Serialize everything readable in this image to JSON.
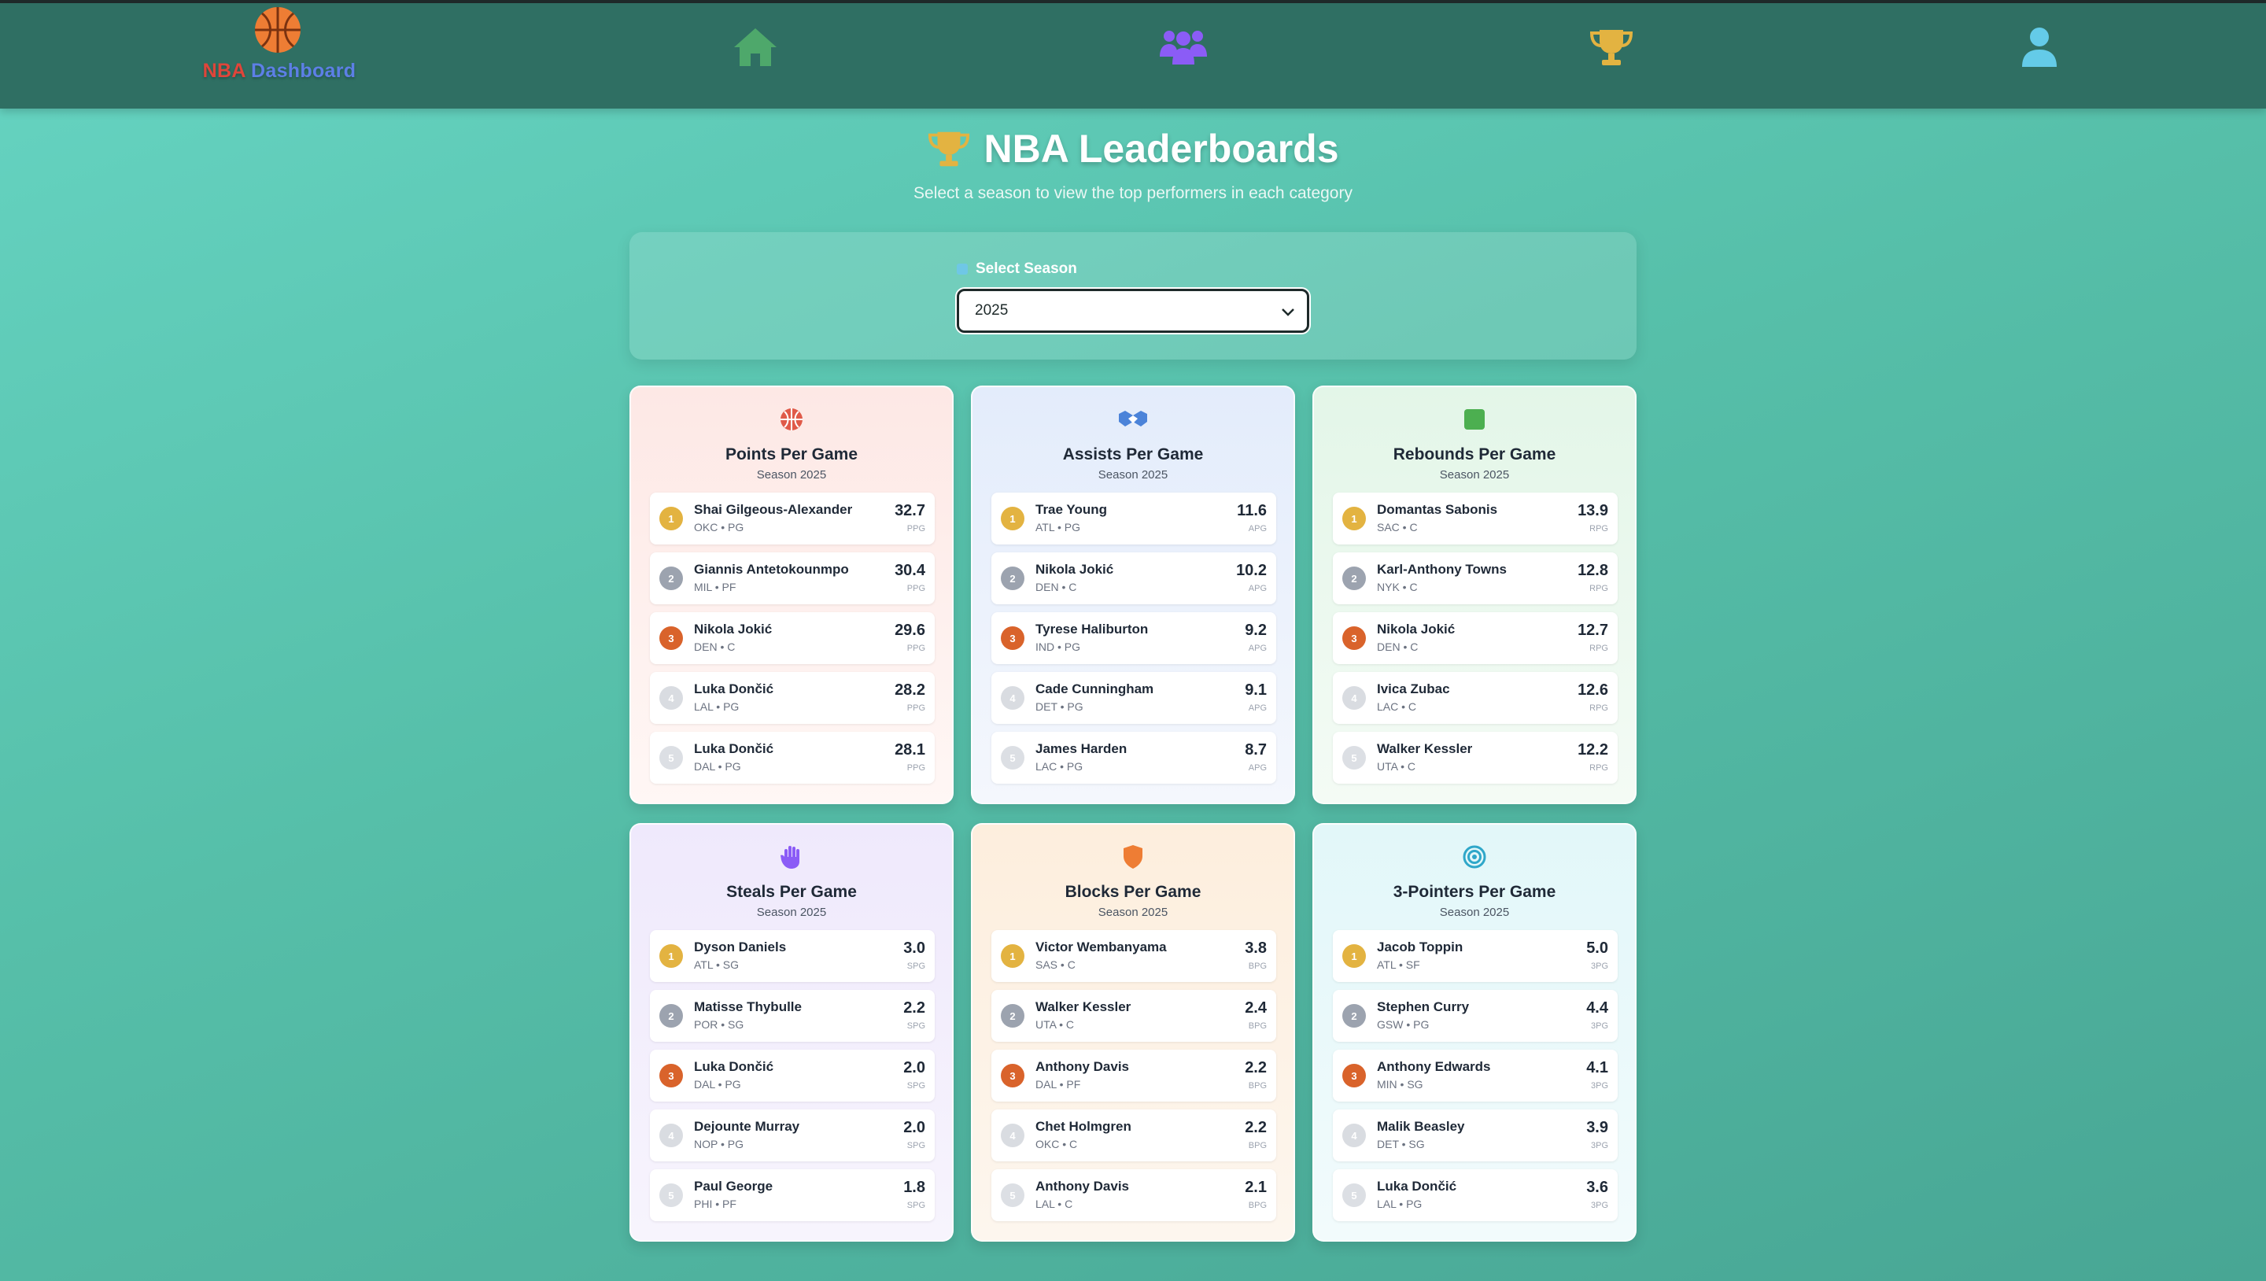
{
  "brand": {
    "nba": "NBA",
    "dashboard": "Dashboard"
  },
  "nav": {
    "icons": [
      "home-icon",
      "teams-icon",
      "trophy-icon",
      "user-icon"
    ],
    "colors": {
      "home": "#4ea86b",
      "teams": "#8b5cf6",
      "trophy": "#e3b341",
      "user": "#64cbe8"
    }
  },
  "header": {
    "title": "NBA Leaderboards",
    "subtitle": "Select a season to view the top performers in each category"
  },
  "season": {
    "label": "Select Season",
    "value": "2025"
  },
  "cards": [
    {
      "title": "Points Per Game",
      "season": "Season 2025",
      "icon": "basketball-icon",
      "players": [
        {
          "rank": "1",
          "name": "Shai Gilgeous-Alexander",
          "meta": "OKC • PG",
          "value": "32.7",
          "unit": "PPG"
        },
        {
          "rank": "2",
          "name": "Giannis Antetokounmpo",
          "meta": "MIL • PF",
          "value": "30.4",
          "unit": "PPG"
        },
        {
          "rank": "3",
          "name": "Nikola Jokić",
          "meta": "DEN • C",
          "value": "29.6",
          "unit": "PPG"
        },
        {
          "rank": "4",
          "name": "Luka Dončić",
          "meta": "LAL • PG",
          "value": "28.2",
          "unit": "PPG"
        },
        {
          "rank": "5",
          "name": "Luka Dončić",
          "meta": "DAL • PG",
          "value": "28.1",
          "unit": "PPG"
        }
      ]
    },
    {
      "title": "Assists Per Game",
      "season": "Season 2025",
      "icon": "handshake-icon",
      "players": [
        {
          "rank": "1",
          "name": "Trae Young",
          "meta": "ATL • PG",
          "value": "11.6",
          "unit": "APG"
        },
        {
          "rank": "2",
          "name": "Nikola Jokić",
          "meta": "DEN • C",
          "value": "10.2",
          "unit": "APG"
        },
        {
          "rank": "3",
          "name": "Tyrese Haliburton",
          "meta": "IND • PG",
          "value": "9.2",
          "unit": "APG"
        },
        {
          "rank": "4",
          "name": "Cade Cunningham",
          "meta": "DET • PG",
          "value": "9.1",
          "unit": "APG"
        },
        {
          "rank": "5",
          "name": "James Harden",
          "meta": "LAC • PG",
          "value": "8.7",
          "unit": "APG"
        }
      ]
    },
    {
      "title": "Rebounds Per Game",
      "season": "Season 2025",
      "icon": "green-square-icon",
      "players": [
        {
          "rank": "1",
          "name": "Domantas Sabonis",
          "meta": "SAC • C",
          "value": "13.9",
          "unit": "RPG"
        },
        {
          "rank": "2",
          "name": "Karl-Anthony Towns",
          "meta": "NYK • C",
          "value": "12.8",
          "unit": "RPG"
        },
        {
          "rank": "3",
          "name": "Nikola Jokić",
          "meta": "DEN • C",
          "value": "12.7",
          "unit": "RPG"
        },
        {
          "rank": "4",
          "name": "Ivica Zubac",
          "meta": "LAC • C",
          "value": "12.6",
          "unit": "RPG"
        },
        {
          "rank": "5",
          "name": "Walker Kessler",
          "meta": "UTA • C",
          "value": "12.2",
          "unit": "RPG"
        }
      ]
    },
    {
      "title": "Steals Per Game",
      "season": "Season 2025",
      "icon": "hand-icon",
      "players": [
        {
          "rank": "1",
          "name": "Dyson Daniels",
          "meta": "ATL • SG",
          "value": "3.0",
          "unit": "SPG"
        },
        {
          "rank": "2",
          "name": "Matisse Thybulle",
          "meta": "POR • SG",
          "value": "2.2",
          "unit": "SPG"
        },
        {
          "rank": "3",
          "name": "Luka Dončić",
          "meta": "DAL • PG",
          "value": "2.0",
          "unit": "SPG"
        },
        {
          "rank": "4",
          "name": "Dejounte Murray",
          "meta": "NOP • PG",
          "value": "2.0",
          "unit": "SPG"
        },
        {
          "rank": "5",
          "name": "Paul George",
          "meta": "PHI • PF",
          "value": "1.8",
          "unit": "SPG"
        }
      ]
    },
    {
      "title": "Blocks Per Game",
      "season": "Season 2025",
      "icon": "shield-icon",
      "players": [
        {
          "rank": "1",
          "name": "Victor Wembanyama",
          "meta": "SAS • C",
          "value": "3.8",
          "unit": "BPG"
        },
        {
          "rank": "2",
          "name": "Walker Kessler",
          "meta": "UTA • C",
          "value": "2.4",
          "unit": "BPG"
        },
        {
          "rank": "3",
          "name": "Anthony Davis",
          "meta": "DAL • PF",
          "value": "2.2",
          "unit": "BPG"
        },
        {
          "rank": "4",
          "name": "Chet Holmgren",
          "meta": "OKC • C",
          "value": "2.2",
          "unit": "BPG"
        },
        {
          "rank": "5",
          "name": "Anthony Davis",
          "meta": "LAL • C",
          "value": "2.1",
          "unit": "BPG"
        }
      ]
    },
    {
      "title": "3-Pointers Per Game",
      "season": "Season 2025",
      "icon": "target-icon",
      "players": [
        {
          "rank": "1",
          "name": "Jacob Toppin",
          "meta": "ATL • SF",
          "value": "5.0",
          "unit": "3PG"
        },
        {
          "rank": "2",
          "name": "Stephen Curry",
          "meta": "GSW • PG",
          "value": "4.4",
          "unit": "3PG"
        },
        {
          "rank": "3",
          "name": "Anthony Edwards",
          "meta": "MIN • SG",
          "value": "4.1",
          "unit": "3PG"
        },
        {
          "rank": "4",
          "name": "Malik Beasley",
          "meta": "DET • SG",
          "value": "3.9",
          "unit": "3PG"
        },
        {
          "rank": "5",
          "name": "Luka Dončić",
          "meta": "LAL • PG",
          "value": "3.6",
          "unit": "3PG"
        }
      ]
    }
  ]
}
